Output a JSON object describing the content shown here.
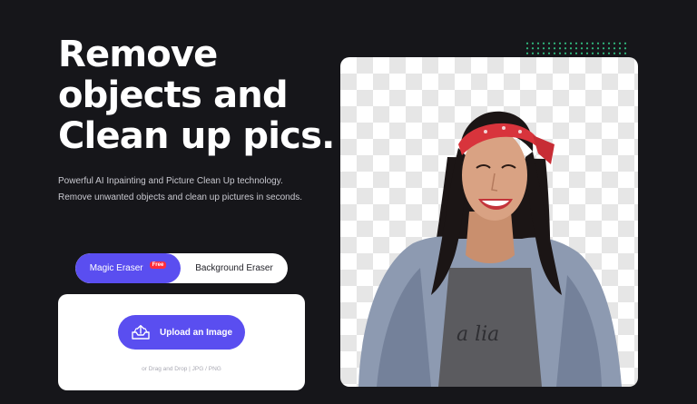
{
  "hero": {
    "title_lines": [
      "Remove",
      "objects and",
      "Clean up pics."
    ],
    "description": "Powerful AI Inpainting and Picture Clean Up technology. Remove unwanted objects and clean up pictures in seconds."
  },
  "tool_tabs": {
    "active_label": "Magic Eraser",
    "active_badge": "Free",
    "inactive_label": "Background Eraser"
  },
  "upload": {
    "button_label": "Upload an Image",
    "hint": "or Drag and Drop | JPG / PNG"
  },
  "colors": {
    "background": "#16161a",
    "accent": "#5a4ef0",
    "badge": "#ff2d3d",
    "dots": "#2fb67c"
  },
  "icons": [
    "upload-tray-icon"
  ]
}
